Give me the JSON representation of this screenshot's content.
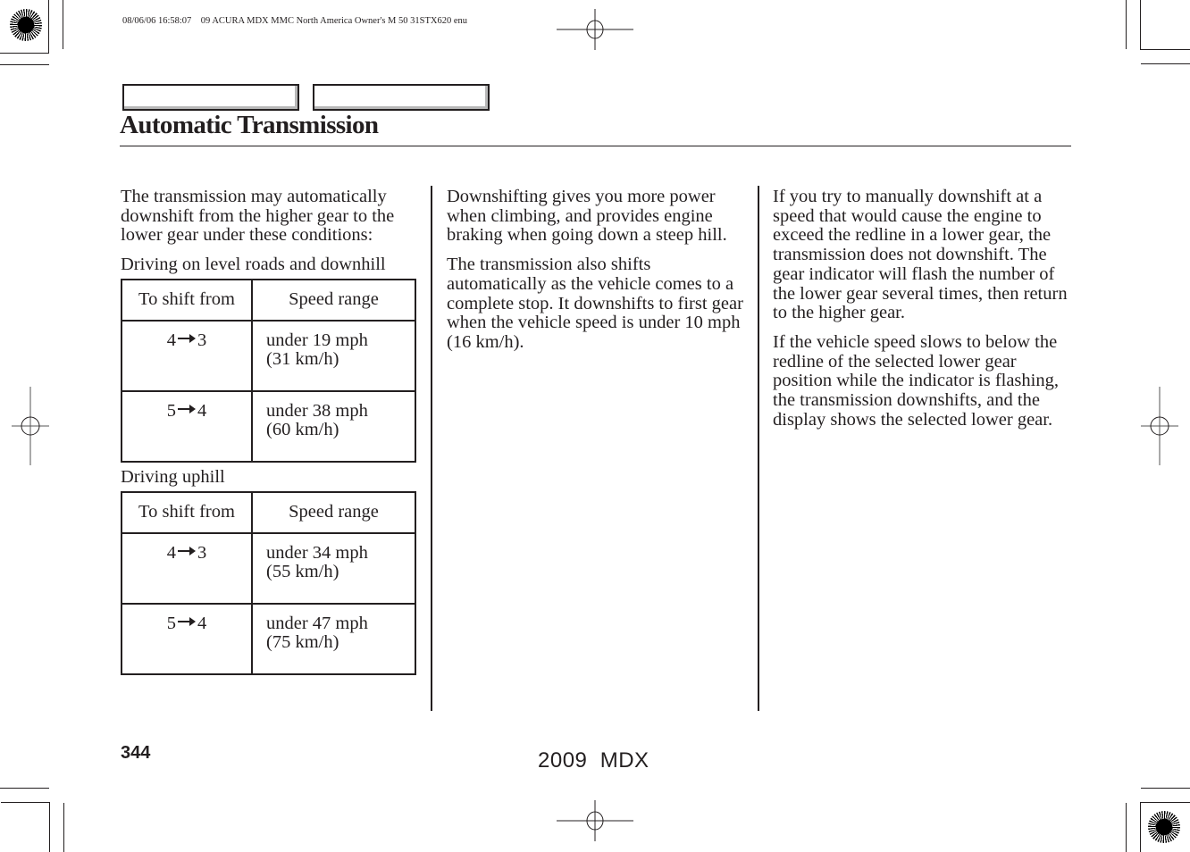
{
  "print_header": {
    "meta": "08/06/06 16:58:07    09 ACURA MDX MMC North America Owner's M 50 31STX620 enu"
  },
  "header": {
    "title": "Automatic Transmission",
    "nav_tabs": [
      "",
      ""
    ]
  },
  "column1": {
    "intro": "The transmission may automatically downshift from the higher gear to the lower gear under these conditions:",
    "tables": [
      {
        "caption": "Driving on level roads and downhill",
        "headers": [
          "To shift from",
          "Speed range"
        ],
        "rows": [
          {
            "from": "4",
            "to": "3",
            "speed": "under 19 mph",
            "metric": "(31 km/h)"
          },
          {
            "from": "5",
            "to": "4",
            "speed": "under 38 mph",
            "metric": "(60 km/h)"
          }
        ]
      },
      {
        "caption": "Driving uphill",
        "headers": [
          "To shift from",
          "Speed range"
        ],
        "rows": [
          {
            "from": "4",
            "to": "3",
            "speed": "under 34 mph",
            "metric": "(55 km/h)"
          },
          {
            "from": "5",
            "to": "4",
            "speed": "under 47 mph",
            "metric": "(75 km/h)"
          }
        ]
      }
    ]
  },
  "column2": {
    "paragraphs": [
      "Downshifting gives you more power when climbing, and provides engine braking when going down a steep hill.",
      "The transmission also shifts automatically as the vehicle comes to a complete stop. It downshifts to first gear when the vehicle speed is under 10 mph (16 km/h)."
    ]
  },
  "column3": {
    "paragraphs": [
      "If you try to manually downshift at a speed that would cause the engine to exceed the redline in a lower gear, the transmission does not downshift. The gear indicator will flash the number of the lower gear several times, then return to the higher gear.",
      "If the vehicle speed slows to below the redline of the selected lower gear position while the indicator is flashing, the transmission downshifts, and the display shows the selected lower gear."
    ]
  },
  "footer": {
    "page_number": "344",
    "model": "2009  MDX"
  },
  "icons": {
    "arrow": "right-arrow-icon",
    "registration": "registration-mark-icon",
    "starburst": "starburst-registration-icon"
  }
}
